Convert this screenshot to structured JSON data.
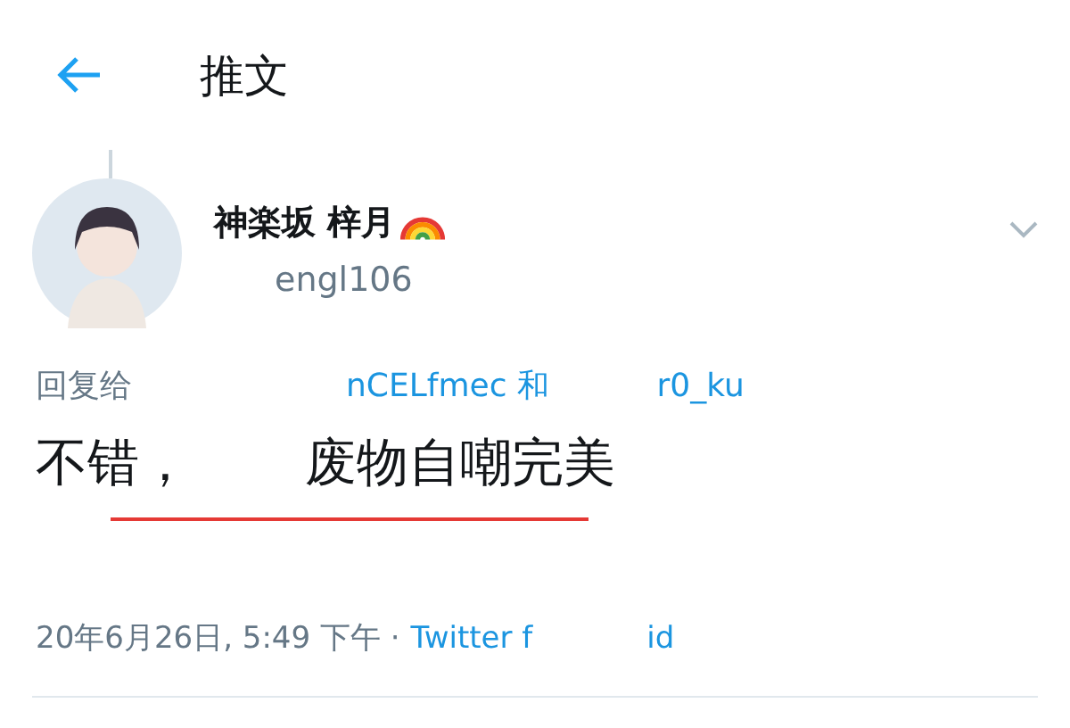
{
  "header": {
    "title": "推文"
  },
  "tweet": {
    "name": "神楽坂 梓月",
    "handle_visible": "engl106",
    "reply_prefix": "回复给",
    "mentions": [
      "nCELfmec",
      "r0_ku"
    ],
    "mention_joiner": "和",
    "text_start": "不错，",
    "text_end": "废物自嘲完美",
    "underlined": true,
    "timestamp": "20年6月26日, 5:49 下午 ·",
    "source_start": "Twitter f",
    "source_end": "id"
  }
}
